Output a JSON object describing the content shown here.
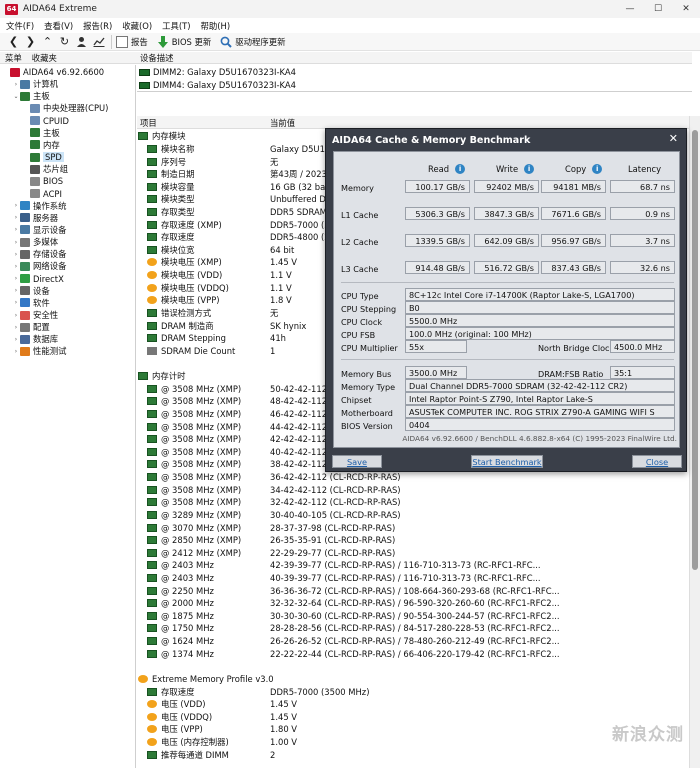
{
  "window": {
    "title": "AIDA64 Extreme",
    "logo": "64",
    "min": "—",
    "max": "☐",
    "close": "✕"
  },
  "menu": [
    "文件(F)",
    "查看(V)",
    "报告(R)",
    "收藏(O)",
    "工具(T)",
    "帮助(H)"
  ],
  "toolbar": {
    "report": "报告",
    "bios": "BIOS 更新",
    "driver": "驱动程序更新"
  },
  "panes": {
    "tab_menu": "菜单",
    "tab_fav": "收藏夹"
  },
  "tree": [
    {
      "label": "AIDA64 v6.92.6600",
      "indent": 0,
      "tw": "",
      "icon": "#c8102e"
    },
    {
      "label": "计算机",
      "indent": 1,
      "tw": "›",
      "icon": "#4a7aa3"
    },
    {
      "label": "主板",
      "indent": 1,
      "tw": "⌄",
      "icon": "#2d7a37"
    },
    {
      "label": "中央处理器(CPU)",
      "indent": 2,
      "tw": "",
      "icon": "#6a8bb3"
    },
    {
      "label": "CPUID",
      "indent": 2,
      "tw": "",
      "icon": "#6a8bb3"
    },
    {
      "label": "主板",
      "indent": 2,
      "tw": "",
      "icon": "#2d7a37"
    },
    {
      "label": "内存",
      "indent": 2,
      "tw": "",
      "icon": "#2d7a37"
    },
    {
      "label": "SPD",
      "indent": 2,
      "tw": "",
      "icon": "#2d7a37"
    },
    {
      "label": "芯片组",
      "indent": 2,
      "tw": "",
      "icon": "#555"
    },
    {
      "label": "BIOS",
      "indent": 2,
      "tw": "",
      "icon": "#888"
    },
    {
      "label": "ACPI",
      "indent": 2,
      "tw": "",
      "icon": "#888"
    },
    {
      "label": "操作系统",
      "indent": 1,
      "tw": "›",
      "icon": "#2f84c4"
    },
    {
      "label": "服务器",
      "indent": 1,
      "tw": "›",
      "icon": "#3a5f8a"
    },
    {
      "label": "显示设备",
      "indent": 1,
      "tw": "›",
      "icon": "#4a7aa3"
    },
    {
      "label": "多媒体",
      "indent": 1,
      "tw": "›",
      "icon": "#777"
    },
    {
      "label": "存储设备",
      "indent": 1,
      "tw": "›",
      "icon": "#666"
    },
    {
      "label": "网络设备",
      "indent": 1,
      "tw": "›",
      "icon": "#3a8a5a"
    },
    {
      "label": "DirectX",
      "indent": 1,
      "tw": "›",
      "icon": "#2f9e44"
    },
    {
      "label": "设备",
      "indent": 1,
      "tw": "›",
      "icon": "#666"
    },
    {
      "label": "软件",
      "indent": 1,
      "tw": "›",
      "icon": "#3478c6"
    },
    {
      "label": "安全性",
      "indent": 1,
      "tw": "›",
      "icon": "#d9534f"
    },
    {
      "label": "配置",
      "indent": 1,
      "tw": "›",
      "icon": "#777"
    },
    {
      "label": "数据库",
      "indent": 1,
      "tw": "›",
      "icon": "#4a6a9a"
    },
    {
      "label": "性能测试",
      "indent": 1,
      "tw": "›",
      "icon": "#e07b1a"
    }
  ],
  "device_pane": {
    "header": "设备描述",
    "items": [
      "DIMM2: Galaxy D5U1670323I-KA4",
      "DIMM4: Galaxy D5U1670323I-KA4"
    ]
  },
  "main": {
    "col_field": "项目",
    "col_value": "当前值",
    "rows": [
      {
        "type": "group",
        "icon": "green",
        "field": "内存模块",
        "value": ""
      },
      {
        "type": "item",
        "icon": "green",
        "field": "模块名称",
        "value": "Galaxy D5U1670"
      },
      {
        "type": "item",
        "icon": "green",
        "field": "序列号",
        "value": "无"
      },
      {
        "type": "item",
        "icon": "green",
        "field": "制造日期",
        "value": "第43周 / 2023"
      },
      {
        "type": "item",
        "icon": "green",
        "field": "模块容量",
        "value": "16 GB (32 banks"
      },
      {
        "type": "item",
        "icon": "green",
        "field": "模块类型",
        "value": "Unbuffered DIM"
      },
      {
        "type": "item",
        "icon": "green",
        "field": "存取类型",
        "value": "DDR5 SDRAM"
      },
      {
        "type": "item",
        "icon": "green",
        "field": "存取速度 (XMP)",
        "value": "DDR5-7000 (35"
      },
      {
        "type": "item",
        "icon": "green",
        "field": "存取速度",
        "value": "DDR5-4800 (24"
      },
      {
        "type": "item",
        "icon": "green",
        "field": "模块位宽",
        "value": "64 bit"
      },
      {
        "type": "item",
        "icon": "orange",
        "field": "模块电压 (XMP)",
        "value": "1.45 V"
      },
      {
        "type": "item",
        "icon": "orange",
        "field": "模块电压 (VDD)",
        "value": "1.1 V"
      },
      {
        "type": "item",
        "icon": "orange",
        "field": "模块电压 (VDDQ)",
        "value": "1.1 V"
      },
      {
        "type": "item",
        "icon": "orange",
        "field": "模块电压 (VPP)",
        "value": "1.8 V"
      },
      {
        "type": "item",
        "icon": "green",
        "field": "错误检测方式",
        "value": "无"
      },
      {
        "type": "item",
        "icon": "green",
        "field": "DRAM 制造商",
        "value": "SK hynix"
      },
      {
        "type": "item",
        "icon": "green",
        "field": "DRAM Stepping",
        "value": "41h"
      },
      {
        "type": "item",
        "icon": "gray",
        "field": "SDRAM Die Count",
        "value": "1"
      },
      {
        "type": "blank",
        "icon": "",
        "field": "",
        "value": ""
      },
      {
        "type": "group",
        "icon": "green",
        "field": "内存计时",
        "value": ""
      },
      {
        "type": "item",
        "icon": "green",
        "field": "@ 3508 MHz (XMP)",
        "value": "50-42-42-112"
      },
      {
        "type": "item",
        "icon": "green",
        "field": "@ 3508 MHz (XMP)",
        "value": "48-42-42-112"
      },
      {
        "type": "item",
        "icon": "green",
        "field": "@ 3508 MHz (XMP)",
        "value": "46-42-42-112"
      },
      {
        "type": "item",
        "icon": "green",
        "field": "@ 3508 MHz (XMP)",
        "value": "44-42-42-112"
      },
      {
        "type": "item",
        "icon": "green",
        "field": "@ 3508 MHz (XMP)",
        "value": "42-42-42-112"
      },
      {
        "type": "item",
        "icon": "green",
        "field": "@ 3508 MHz (XMP)",
        "value": "40-42-42-112"
      },
      {
        "type": "item",
        "icon": "green",
        "field": "@ 3508 MHz (XMP)",
        "value": "38-42-42-112"
      },
      {
        "type": "item",
        "icon": "green",
        "field": "@ 3508 MHz (XMP)",
        "value": "36-42-42-112  (CL-RCD-RP-RAS)"
      },
      {
        "type": "item",
        "icon": "green",
        "field": "@ 3508 MHz (XMP)",
        "value": "34-42-42-112  (CL-RCD-RP-RAS)"
      },
      {
        "type": "item",
        "icon": "green",
        "field": "@ 3508 MHz (XMP)",
        "value": "32-42-42-112  (CL-RCD-RP-RAS)"
      },
      {
        "type": "item",
        "icon": "green",
        "field": "@ 3289 MHz (XMP)",
        "value": "30-40-40-105  (CL-RCD-RP-RAS)"
      },
      {
        "type": "item",
        "icon": "green",
        "field": "@ 3070 MHz (XMP)",
        "value": "28-37-37-98  (CL-RCD-RP-RAS)"
      },
      {
        "type": "item",
        "icon": "green",
        "field": "@ 2850 MHz (XMP)",
        "value": "26-35-35-91  (CL-RCD-RP-RAS)"
      },
      {
        "type": "item",
        "icon": "green",
        "field": "@ 2412 MHz (XMP)",
        "value": "22-29-29-77  (CL-RCD-RP-RAS)"
      },
      {
        "type": "item",
        "icon": "green",
        "field": "@ 2403 MHz",
        "value": "42-39-39-77  (CL-RCD-RP-RAS) / 116-710-313-73  (RC-RFC1-RFC..."
      },
      {
        "type": "item",
        "icon": "green",
        "field": "@ 2403 MHz",
        "value": "40-39-39-77  (CL-RCD-RP-RAS) / 116-710-313-73  (RC-RFC1-RFC..."
      },
      {
        "type": "item",
        "icon": "green",
        "field": "@ 2250 MHz",
        "value": "36-36-36-72  (CL-RCD-RP-RAS) / 108-664-360-293-68  (RC-RFC1-RFC..."
      },
      {
        "type": "item",
        "icon": "green",
        "field": "@ 2000 MHz",
        "value": "32-32-32-64  (CL-RCD-RP-RAS) / 96-590-320-260-60  (RC-RFC1-RFC2..."
      },
      {
        "type": "item",
        "icon": "green",
        "field": "@ 1875 MHz",
        "value": "30-30-30-60  (CL-RCD-RP-RAS) / 90-554-300-244-57  (RC-RFC1-RFC2..."
      },
      {
        "type": "item",
        "icon": "green",
        "field": "@ 1750 MHz",
        "value": "28-28-28-56  (CL-RCD-RP-RAS) / 84-517-280-228-53  (RC-RFC1-RFC2..."
      },
      {
        "type": "item",
        "icon": "green",
        "field": "@ 1624 MHz",
        "value": "26-26-26-52  (CL-RCD-RP-RAS) / 78-480-260-212-49  (RC-RFC1-RFC2..."
      },
      {
        "type": "item",
        "icon": "green",
        "field": "@ 1374 MHz",
        "value": "22-22-22-44  (CL-RCD-RP-RAS) / 66-406-220-179-42  (RC-RFC1-RFC2..."
      },
      {
        "type": "blank",
        "icon": "",
        "field": "",
        "value": ""
      },
      {
        "type": "group",
        "icon": "orange",
        "field": "Extreme Memory Profile v3.0",
        "value": ""
      },
      {
        "type": "item",
        "icon": "green",
        "field": "存取速度",
        "value": "DDR5-7000 (3500 MHz)"
      },
      {
        "type": "item",
        "icon": "orange",
        "field": "电压 (VDD)",
        "value": "1.45 V"
      },
      {
        "type": "item",
        "icon": "orange",
        "field": "电压 (VDDQ)",
        "value": "1.45 V"
      },
      {
        "type": "item",
        "icon": "orange",
        "field": "电压 (VPP)",
        "value": "1.80 V"
      },
      {
        "type": "item",
        "icon": "orange",
        "field": "电压 (内存控制器)",
        "value": "1.00 V"
      },
      {
        "type": "item",
        "icon": "green",
        "field": "推荐每通道 DIMM",
        "value": "2"
      }
    ]
  },
  "watermark": "新浪众测",
  "bench": {
    "title": "AIDA64 Cache & Memory Benchmark",
    "close": "✕",
    "col_read": "Read",
    "col_write": "Write",
    "col_copy": "Copy",
    "col_latency": "Latency",
    "info": "i",
    "rows": [
      {
        "label": "Memory",
        "read": "100.17 GB/s",
        "write": "92402 MB/s",
        "copy": "94181 MB/s",
        "latency": "68.7 ns"
      },
      {
        "label": "L1 Cache",
        "read": "5306.3 GB/s",
        "write": "3847.3 GB/s",
        "copy": "7671.6 GB/s",
        "latency": "0.9 ns"
      },
      {
        "label": "L2 Cache",
        "read": "1339.5 GB/s",
        "write": "642.09 GB/s",
        "copy": "956.97 GB/s",
        "latency": "3.7 ns"
      },
      {
        "label": "L3 Cache",
        "read": "914.48 GB/s",
        "write": "516.72 GB/s",
        "copy": "837.43 GB/s",
        "latency": "32.6 ns"
      }
    ],
    "cpu_type_label": "CPU Type",
    "cpu_type": "8C+12c Intel Core i7-14700K  (Raptor Lake-S, LGA1700)",
    "cpu_stepping_label": "CPU Stepping",
    "cpu_stepping": "B0",
    "cpu_clock_label": "CPU Clock",
    "cpu_clock": "5500.0 MHz",
    "cpu_fsb_label": "CPU FSB",
    "cpu_fsb": "100.0 MHz  (original: 100 MHz)",
    "cpu_mult_label": "CPU Multiplier",
    "cpu_mult": "55x",
    "nb_clock_label": "North Bridge Clock",
    "nb_clock": "4500.0 MHz",
    "mem_bus_label": "Memory Bus",
    "mem_bus": "3500.0 MHz",
    "ratio_label": "DRAM:FSB Ratio",
    "ratio": "35:1",
    "mem_type_label": "Memory Type",
    "mem_type": "Dual Channel DDR5-7000 SDRAM  (32-42-42-112 CR2)",
    "chipset_label": "Chipset",
    "chipset": "Intel Raptor Point-S Z790, Intel Raptor Lake-S",
    "mb_label": "Motherboard",
    "mb": "ASUSTeK COMPUTER INC. ROG STRIX Z790-A GAMING WIFI S",
    "bios_label": "BIOS Version",
    "bios": "0404",
    "footer": "AIDA64 v6.92.6600 / BenchDLL 4.6.882.8-x64  (C) 1995-2023 FinalWire Ltd.",
    "save": "Save",
    "start": "Start Benchmark",
    "close_btn": "Close"
  }
}
